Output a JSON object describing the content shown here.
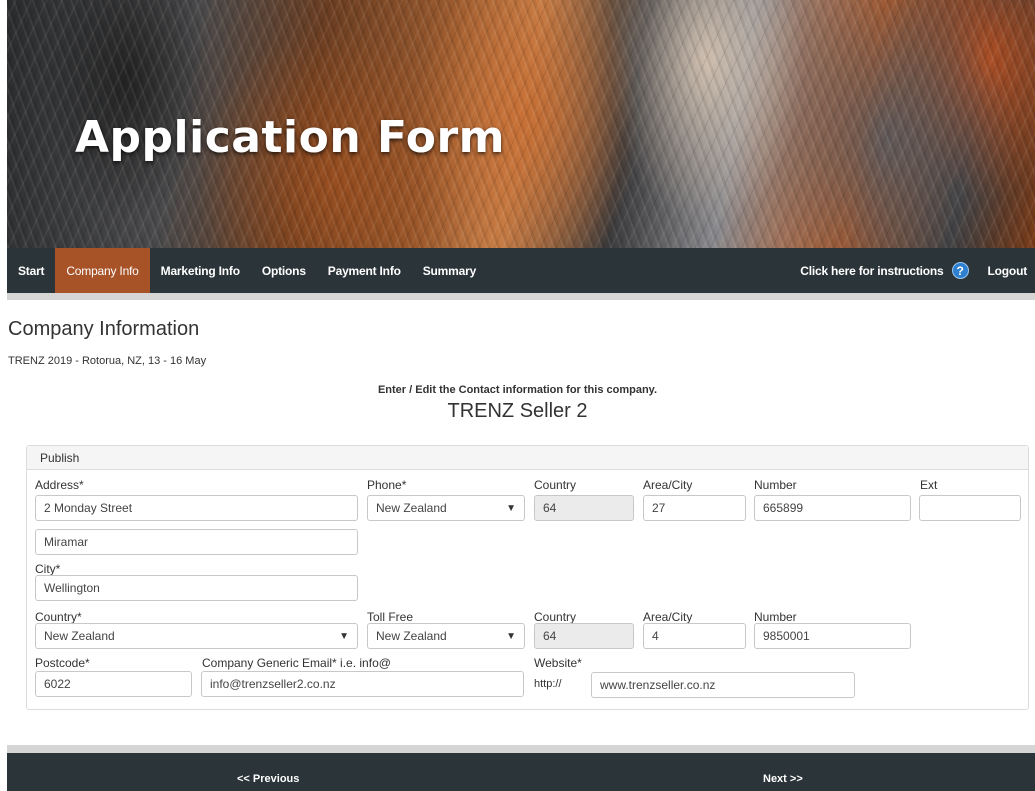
{
  "header": {
    "title": "Application Form"
  },
  "nav": {
    "items": [
      {
        "label": "Start"
      },
      {
        "label": "Company Info"
      },
      {
        "label": "Marketing Info"
      },
      {
        "label": "Options"
      },
      {
        "label": "Payment Info"
      },
      {
        "label": "Summary"
      }
    ],
    "instructions": "Click here for instructions",
    "help_glyph": "?",
    "logout": "Logout",
    "active_color": "#a85228",
    "bar_color": "#2b3439"
  },
  "page": {
    "title": "Company Information",
    "event": "TRENZ 2019 - Rotorua, NZ, 13 - 16 May",
    "instructions": "Enter / Edit the Contact information for this company.",
    "company_name": "TRENZ Seller 2"
  },
  "panel": {
    "heading": "Publish",
    "address": {
      "label": "Address*",
      "line1": "2 Monday Street",
      "line2": "Miramar"
    },
    "city": {
      "label": "City*",
      "value": "Wellington"
    },
    "country": {
      "label": "Country*",
      "value": "New Zealand"
    },
    "postcode": {
      "label": "Postcode*",
      "value": "6022"
    },
    "email": {
      "label": "Company Generic Email* i.e. info@",
      "value": "info@trenzseller2.co.nz"
    },
    "phone": {
      "label": "Phone*",
      "country_select": "New Zealand",
      "country_label": "Country",
      "country_code": "64",
      "area_label": "Area/City",
      "area": "27",
      "number_label": "Number",
      "number": "665899",
      "ext_label": "Ext",
      "ext": ""
    },
    "tollfree": {
      "label": "Toll Free",
      "country_select": "New Zealand",
      "country_label": "Country",
      "country_code": "64",
      "area_label": "Area/City",
      "area": "4",
      "number_label": "Number",
      "number": "9850001"
    },
    "website": {
      "label": "Website*",
      "prefix": "http://",
      "value": "www.trenzseller.co.nz"
    }
  },
  "footer": {
    "previous": "<< Previous",
    "next": "Next >>"
  }
}
